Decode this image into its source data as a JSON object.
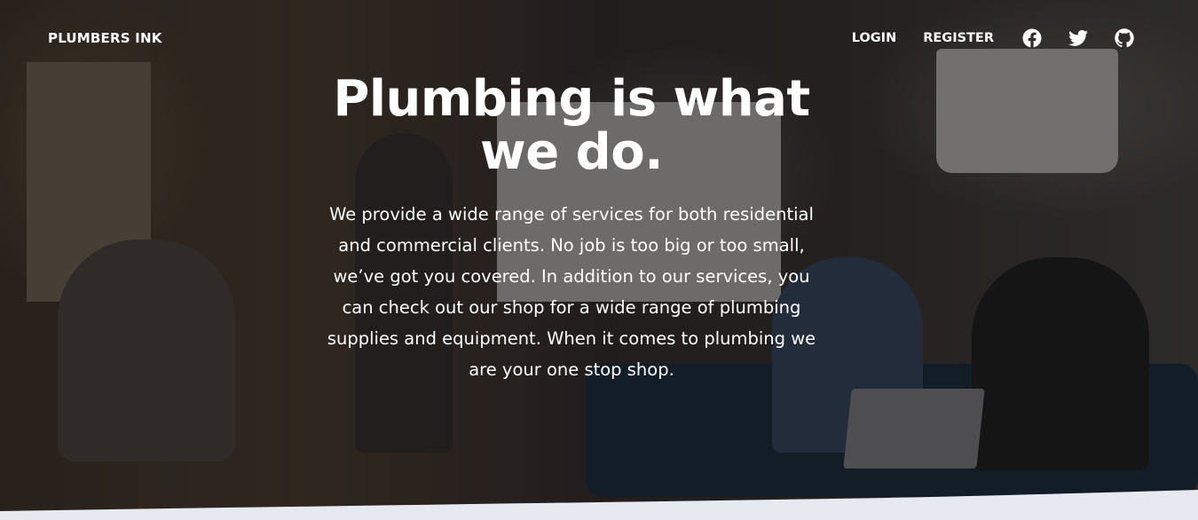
{
  "brand": "PLUMBERS INK",
  "nav": {
    "login": "LOGIN",
    "register": "REGISTER"
  },
  "social": [
    "facebook-icon",
    "twitter-icon",
    "github-icon"
  ],
  "hero": {
    "title": "Plumbing is what we do.",
    "description": "We provide a wide range of services for both residential and commercial clients. No job is too big or too small, we’ve got you covered. In addition to our services, you can check out our shop for a wide range of plumbing supplies and equipment. When it comes to plumbing we are your one stop shop."
  },
  "colors": {
    "text": "#ffffff",
    "wave": "#e6e9ef",
    "overlay": "#0a0a0c"
  }
}
